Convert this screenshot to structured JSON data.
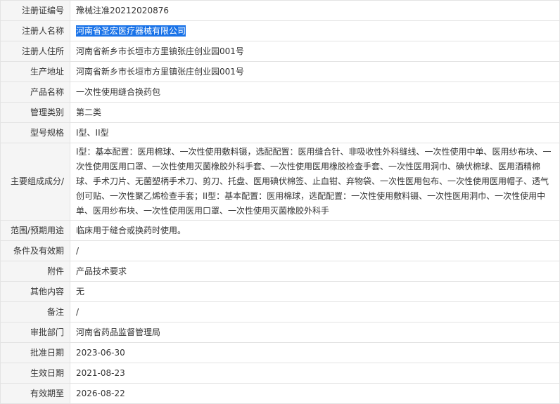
{
  "rows": [
    {
      "label": "注册证编号",
      "value": "豫械注准20212020876"
    },
    {
      "label": "注册人名称",
      "value": "河南省圣宏医疗器械有限公司"
    },
    {
      "label": "注册人住所",
      "value": "河南省新乡市长垣市方里镇张庄创业园001号"
    },
    {
      "label": "生产地址",
      "value": "河南省新乡市长垣市方里镇张庄创业园001号"
    },
    {
      "label": "产品名称",
      "value": "一次性使用缝合换药包"
    },
    {
      "label": "管理类别",
      "value": "第二类"
    },
    {
      "label": "型号规格",
      "value": "I型、II型"
    },
    {
      "label": "/主要组成成分",
      "value": "I型：基本配置：医用棉球、一次性使用敷料镊，选配配置：医用缝合针、非吸收性外科缝线、一次性使用中单、医用纱布块、一次性使用医用口罩、一次性使用灭菌橡胶外科手套、一次性使用医用橡胶检查手套、一次性医用洞巾、碘伏棉球、医用酒精棉球、手术刀片、无菌塑柄手术刀、剪刀、托盘、医用碘伏棉签、止血钳、弃物袋、一次性医用包布、一次性使用医用帽子、透气创可贴、一次性聚乙烯检查手套；II型：基本配置：医用棉球，选配配置：一次性使用敷料镊、一次性医用洞巾、一次性使用中单、医用纱布块、一次性使用医用口罩、一次性使用灭菌橡胶外科手"
    },
    {
      "label": "范围/预期用途",
      "value": "临床用于缝合或换药时使用。"
    },
    {
      "label": "条件及有效期",
      "value": "/"
    },
    {
      "label": "附件",
      "value": "产品技术要求"
    },
    {
      "label": "其他内容",
      "value": "无"
    },
    {
      "label": "备注",
      "value": "/"
    },
    {
      "label": "审批部门",
      "value": "河南省药品监督管理局"
    },
    {
      "label": "批准日期",
      "value": "2023-06-30"
    },
    {
      "label": "生效日期",
      "value": "2021-08-23"
    },
    {
      "label": "有效期至",
      "value": "2026-08-22"
    }
  ],
  "colors": {
    "label_bg": "#f5f5f5",
    "border": "#e3e3e3",
    "selection": "#1a73e8"
  }
}
